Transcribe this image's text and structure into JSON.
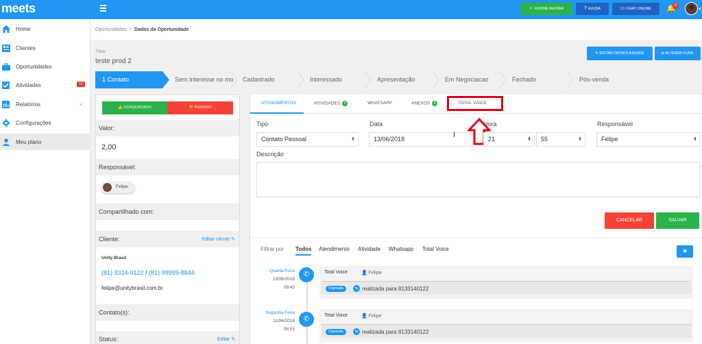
{
  "app": {
    "logo": "meets"
  },
  "header": {
    "buttons": [
      {
        "label": "ASSINE AGORA!",
        "icon": "star-icon",
        "color": "#2bb24c"
      },
      {
        "label": "AJUDA",
        "icon": "question-icon",
        "color": "#1e63c4"
      },
      {
        "label": "CHAT ONLINE",
        "icon": "chat-icon",
        "color": "#1e63c4"
      }
    ],
    "notifications_count": "0"
  },
  "sidebar": {
    "items": [
      {
        "label": "Home",
        "icon": "home-icon"
      },
      {
        "label": "Clientes",
        "icon": "clients-icon"
      },
      {
        "label": "Oportunidades",
        "icon": "briefcase-icon"
      },
      {
        "label": "Atividades",
        "icon": "checkbox-icon",
        "badge": "15"
      },
      {
        "label": "Relatórios",
        "icon": "chart-icon"
      },
      {
        "label": "Configurações",
        "icon": "gear-icon"
      },
      {
        "label": "Meu plano",
        "icon": "user-icon"
      }
    ]
  },
  "breadcrumb": {
    "parent": "Oportunidades",
    "separator": "/",
    "current": "Dados da Oportunidade"
  },
  "opportunity": {
    "title_label": "Título",
    "title_value": "teste prod 2",
    "edit_button": "EDITAR OPORTUNIDADE",
    "funnel_button": "ALTERAR FUNIL"
  },
  "pipeline": {
    "stages": [
      "1 Contato",
      "Sem Interesse no mo",
      "Cadastrado",
      "Interessado",
      "Apresentação",
      "Em Negociacao",
      "Fechado",
      "Pós-venda"
    ]
  },
  "left_panel": {
    "won_button": "CONQUISTADO",
    "lost_button": "PERDIDO",
    "value_label": "Valor:",
    "value": "2,00",
    "responsible_label": "Responsável:",
    "responsible_name": "Felipe",
    "shared_label": "Compartilhado com:",
    "client_label": "Cliente:",
    "client_edit": "Editar cliente",
    "client_name": "Unity Brasil",
    "phone1": "(81) 3314-0122",
    "phone_sep": " / ",
    "phone2": "(81) 99999-8844",
    "email": "felipe@unitybrasil.com.br",
    "contacts_label": "Contato(s):",
    "status_label": "Status:",
    "status_edit": "Editar"
  },
  "tabs": [
    {
      "label": "ATENDIMENTOS"
    },
    {
      "label": "ATIVIDADES",
      "count": "0"
    },
    {
      "label": "WHATSAPP"
    },
    {
      "label": "ANEXOS",
      "count": "0"
    },
    {
      "label": "TOTAL VOICE"
    }
  ],
  "form": {
    "tipo_label": "Tipo",
    "tipo_value": "Contato Pessoal",
    "data_label": "Data",
    "data_value": "13/06/2018",
    "hora_label": "Hora",
    "hora_value": "21",
    "minuto_value": "55",
    "responsavel_label": "Responsável",
    "responsavel_value": "Felipe",
    "descricao_label": "Descrição",
    "cancel_button": "CANCELAR",
    "save_button": "SALVAR"
  },
  "filters": {
    "label": "Filtrar por",
    "options": [
      "Todos",
      "Atendimento",
      "Atividade",
      "Whatsapp",
      "Total Voice"
    ]
  },
  "timeline": [
    {
      "weekday": "Quarta-Feira",
      "date": "13/06/2018",
      "time": "09:42",
      "title": "Total Voice",
      "user": "Felipe",
      "tag": "Chamada",
      "text": "realizada para 8133140122"
    },
    {
      "weekday": "Segunda-Feira",
      "date": "11/06/2018",
      "time": "08:51",
      "title": "Total Voice",
      "user": "Felipe",
      "tag": "Chamada",
      "text": "realizada para 8133140122"
    }
  ]
}
